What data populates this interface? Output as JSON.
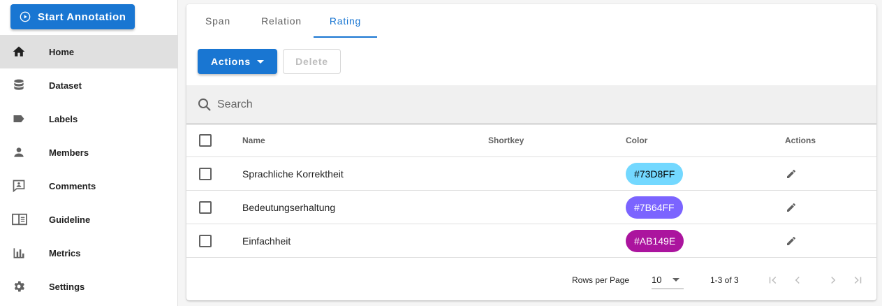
{
  "sidebar": {
    "start_button": "Start Annotation",
    "items": [
      {
        "label": "Home",
        "icon": "home-icon",
        "active": true
      },
      {
        "label": "Dataset",
        "icon": "database-icon"
      },
      {
        "label": "Labels",
        "icon": "label-icon"
      },
      {
        "label": "Members",
        "icon": "person-icon"
      },
      {
        "label": "Comments",
        "icon": "comment-icon"
      },
      {
        "label": "Guideline",
        "icon": "book-icon"
      },
      {
        "label": "Metrics",
        "icon": "bar-chart-icon"
      },
      {
        "label": "Settings",
        "icon": "gear-icon"
      }
    ]
  },
  "tabs": [
    {
      "label": "Span"
    },
    {
      "label": "Relation"
    },
    {
      "label": "Rating",
      "active": true
    }
  ],
  "toolbar": {
    "actions_label": "Actions",
    "delete_label": "Delete"
  },
  "search": {
    "placeholder": "Search"
  },
  "table": {
    "columns": [
      "Name",
      "Shortkey",
      "Color",
      "Actions"
    ],
    "rows": [
      {
        "name": "Sprachliche Korrektheit",
        "shortkey": "",
        "color": "#73D8FF",
        "chip_bg": "#73D8FF",
        "chip_fg": "#000000"
      },
      {
        "name": "Bedeutungserhaltung",
        "shortkey": "",
        "color": "#7B64FF",
        "chip_bg": "#7B64FF",
        "chip_fg": "#ffffff"
      },
      {
        "name": "Einfachheit",
        "shortkey": "",
        "color": "#AB149E",
        "chip_bg": "#AB149E",
        "chip_fg": "#ffffff"
      }
    ]
  },
  "footer": {
    "rows_per_page_label": "Rows per Page",
    "rows_per_page_value": "10",
    "range": "1-3 of 3"
  },
  "colors": {
    "primary": "#1976d2"
  }
}
